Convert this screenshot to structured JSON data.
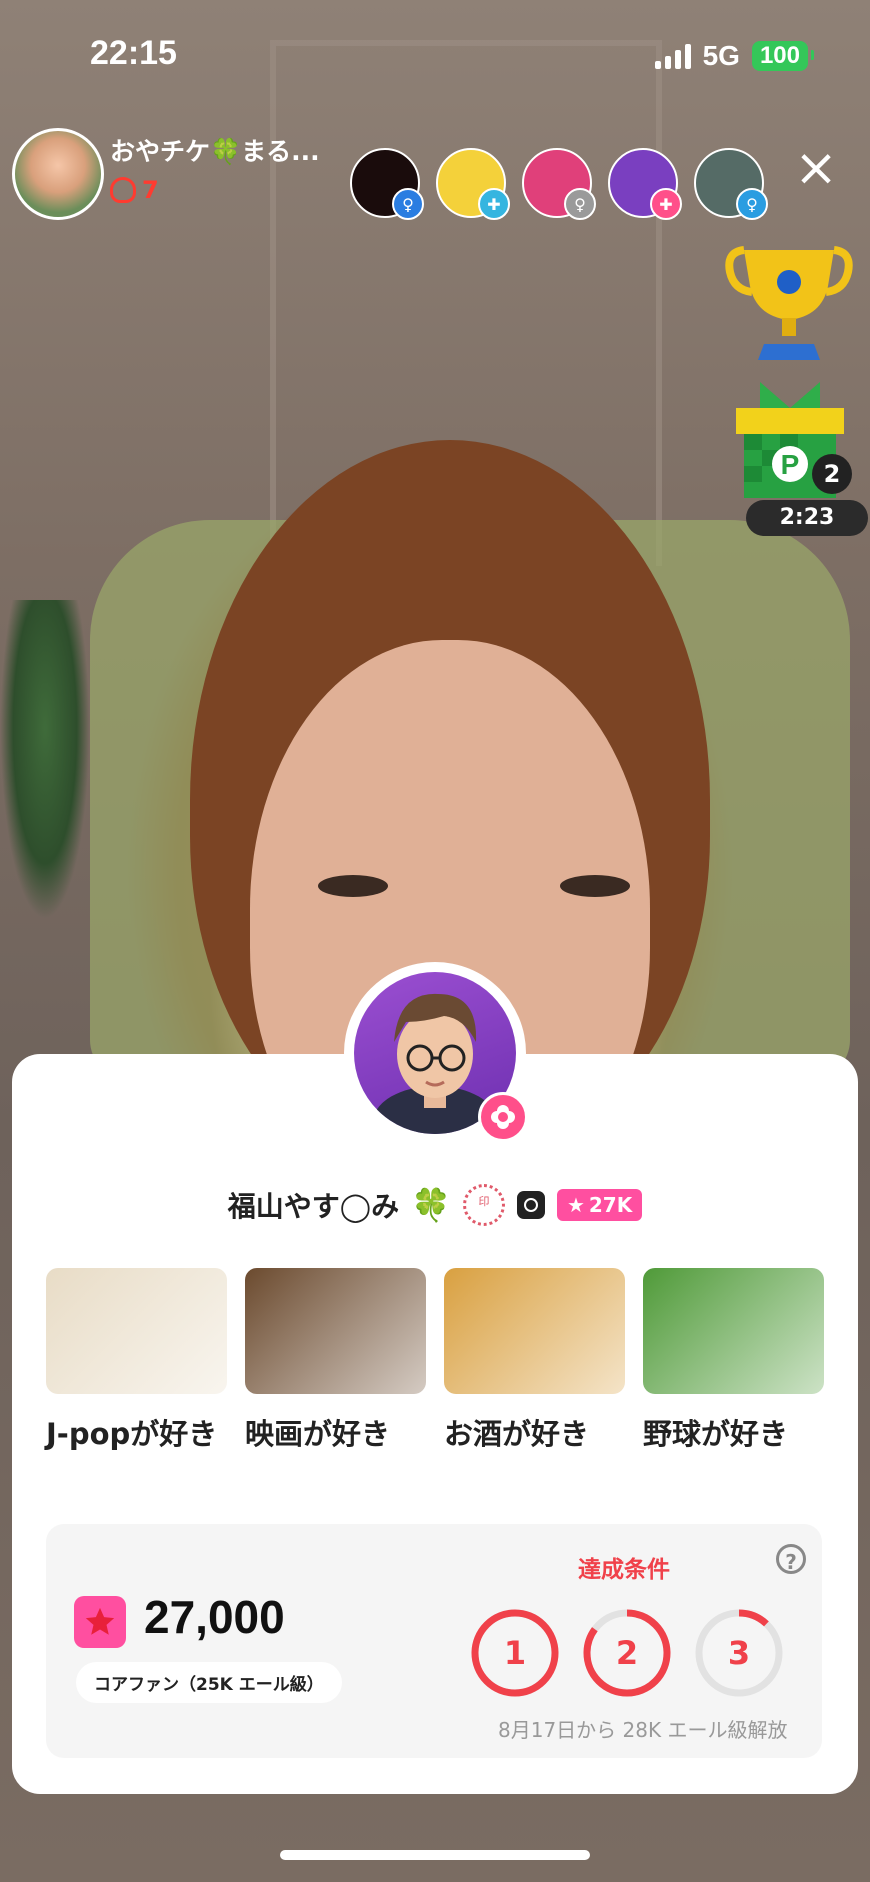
{
  "status_bar": {
    "time": "22:15",
    "network": "5G",
    "battery": "100"
  },
  "host": {
    "name": "おやチケ🍀まる...",
    "fire_count": "7"
  },
  "viewers": [
    {
      "name": "viewer-1",
      "color": "#1a0c0c",
      "badge_color": "#2a7de1",
      "badge": "♀"
    },
    {
      "name": "viewer-2",
      "color": "#f4d13a",
      "badge_color": "#35b5e0",
      "badge": "✚"
    },
    {
      "name": "viewer-3",
      "color": "#e0407a",
      "badge_color": "#9a9a9a",
      "badge": "♀"
    },
    {
      "name": "viewer-4",
      "color": "#7a3fc0",
      "badge_color": "#ff4f8a",
      "badge": "✚"
    },
    {
      "name": "viewer-5",
      "color": "#556b66",
      "badge_color": "#2a9de1",
      "badge": "♀"
    }
  ],
  "widgets": {
    "gift_count": "2",
    "timer": "2:23"
  },
  "profile": {
    "name": "福山やす◯み",
    "clover": "🍀",
    "seal": "印",
    "fan_level": "27K"
  },
  "interests": [
    {
      "label": "J-popが好き",
      "thumb": "piano-jpop-thumbnail",
      "color": "#e8dcc6"
    },
    {
      "label": "映画が好き",
      "thumb": "movie-clapper-thumbnail",
      "color": "#6b4a2e"
    },
    {
      "label": "お酒が好き",
      "thumb": "beer-cheers-thumbnail",
      "color": "#d9a040"
    },
    {
      "label": "野球が好き",
      "thumb": "baseball-glove-thumbnail",
      "color": "#4f9a38"
    }
  ],
  "stats": {
    "value": "27,000",
    "level_label": "コアファン（25K エール級）",
    "achieve_title": "達成条件",
    "help": "?",
    "conditions": [
      {
        "label": "1",
        "progress": 1.0
      },
      {
        "label": "2",
        "progress": 0.85
      },
      {
        "label": "3",
        "progress": 0.12
      }
    ],
    "note": "8月17日から 28K エール級解放"
  },
  "colors": {
    "accent": "#f0414a",
    "pink": "#ff4fa0",
    "battery": "#34c759"
  }
}
